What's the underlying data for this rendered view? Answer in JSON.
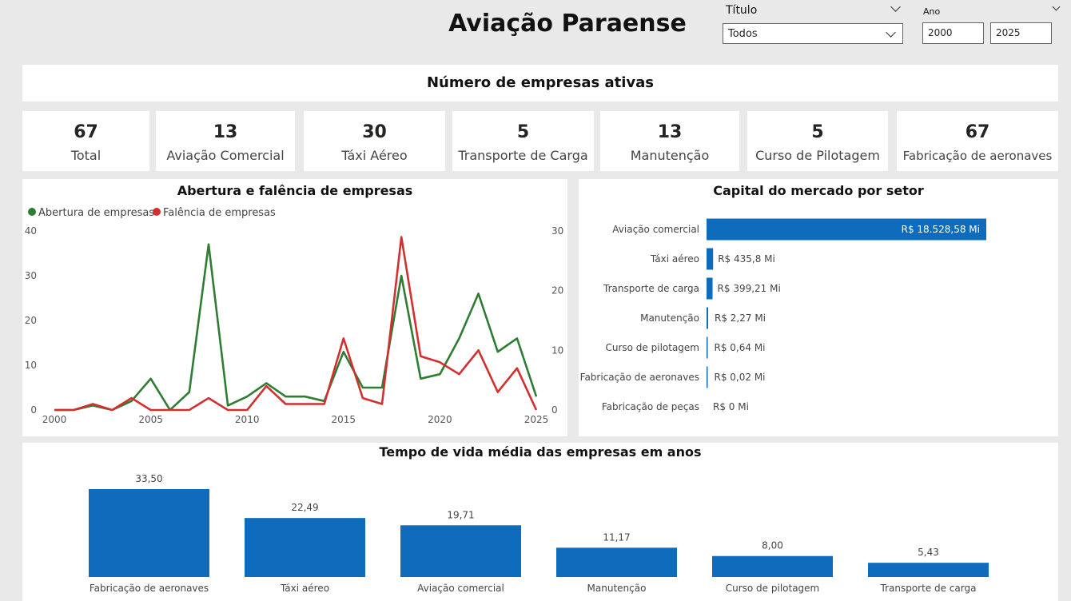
{
  "header": {
    "title": "Aviação Paraense",
    "slicer_title": {
      "label": "Título",
      "value": "Todos"
    },
    "slicer_year": {
      "label": "Ano",
      "start": "2000",
      "end": "2025"
    }
  },
  "kpi_header": "Número de empresas ativas",
  "kpis": [
    {
      "value": "67",
      "label": "Total"
    },
    {
      "value": "13",
      "label": "Aviação Comercial"
    },
    {
      "value": "30",
      "label": "Táxi Aéreo"
    },
    {
      "value": "5",
      "label": "Transporte de Carga"
    },
    {
      "value": "13",
      "label": "Manutenção"
    },
    {
      "value": "5",
      "label": "Curso de Pilotagem"
    },
    {
      "value": "67",
      "label": "Fabricação de aeronaves"
    }
  ],
  "colors": {
    "green": "#2e7d32",
    "red": "#d32f2f",
    "blue": "#0f6cbd"
  },
  "chart_data": [
    {
      "type": "line",
      "title": "Abertura e falência de empresas",
      "x": [
        2000,
        2001,
        2002,
        2003,
        2004,
        2005,
        2006,
        2007,
        2008,
        2009,
        2010,
        2011,
        2012,
        2013,
        2014,
        2015,
        2016,
        2017,
        2018,
        2019,
        2020,
        2021,
        2022,
        2023,
        2024,
        2025
      ],
      "xticks": [
        "2000",
        "2005",
        "2010",
        "2015",
        "2020",
        "2025"
      ],
      "series": [
        {
          "name": "Abertura de empresas",
          "axis": "left",
          "color": "#2e7d32",
          "values": [
            0,
            0,
            1,
            0,
            2,
            7,
            0,
            4,
            37,
            1,
            3,
            6,
            3,
            3,
            2,
            13,
            5,
            5,
            30,
            7,
            8,
            16,
            26,
            13,
            16,
            3
          ]
        },
        {
          "name": "Falência de empresas",
          "axis": "right",
          "color": "#d32f2f",
          "values": [
            0,
            0,
            1,
            0,
            2,
            0,
            0,
            0,
            2,
            0,
            0,
            4,
            1,
            1,
            1,
            12,
            2,
            1,
            29,
            9,
            8,
            6,
            10,
            3,
            7,
            0
          ]
        }
      ],
      "y_left": {
        "ticks": [
          "0",
          "10",
          "20",
          "30",
          "40"
        ],
        "ylim": [
          0,
          40
        ]
      },
      "y_right": {
        "ticks": [
          "0",
          "10",
          "20",
          "30"
        ],
        "ylim": [
          0,
          30
        ]
      },
      "legend": "top-left"
    },
    {
      "type": "bar",
      "orientation": "horizontal",
      "title": "Capital do mercado por setor",
      "categories": [
        "Aviação comercial",
        "Táxi aéreo",
        "Transporte de carga",
        "Manutenção",
        "Curso de pilotagem",
        "Fabricação de aeronaves",
        "Fabricação de peças"
      ],
      "values": [
        18528.58,
        435.8,
        399.21,
        2.27,
        0.64,
        0.02,
        0
      ],
      "labels": [
        "R$ 18.528,58 Mi",
        "R$ 435,8 Mi",
        "R$ 399,21 Mi",
        "R$ 2,27 Mi",
        "R$ 0,64 Mi",
        "R$ 0,02 Mi",
        "R$ 0 Mi"
      ],
      "color": "#0f6cbd"
    },
    {
      "type": "bar",
      "title": "Tempo de vida média das empresas em anos",
      "categories": [
        "Fabricação de aeronaves",
        "Táxi aéreo",
        "Aviação comercial",
        "Manutenção",
        "Curso de pilotagem",
        "Transporte de carga"
      ],
      "values": [
        33.5,
        22.49,
        19.71,
        11.17,
        8.0,
        5.43
      ],
      "labels": [
        "33,50",
        "22,49",
        "19,71",
        "11,17",
        "8,00",
        "5,43"
      ],
      "color": "#0f6cbd"
    }
  ]
}
